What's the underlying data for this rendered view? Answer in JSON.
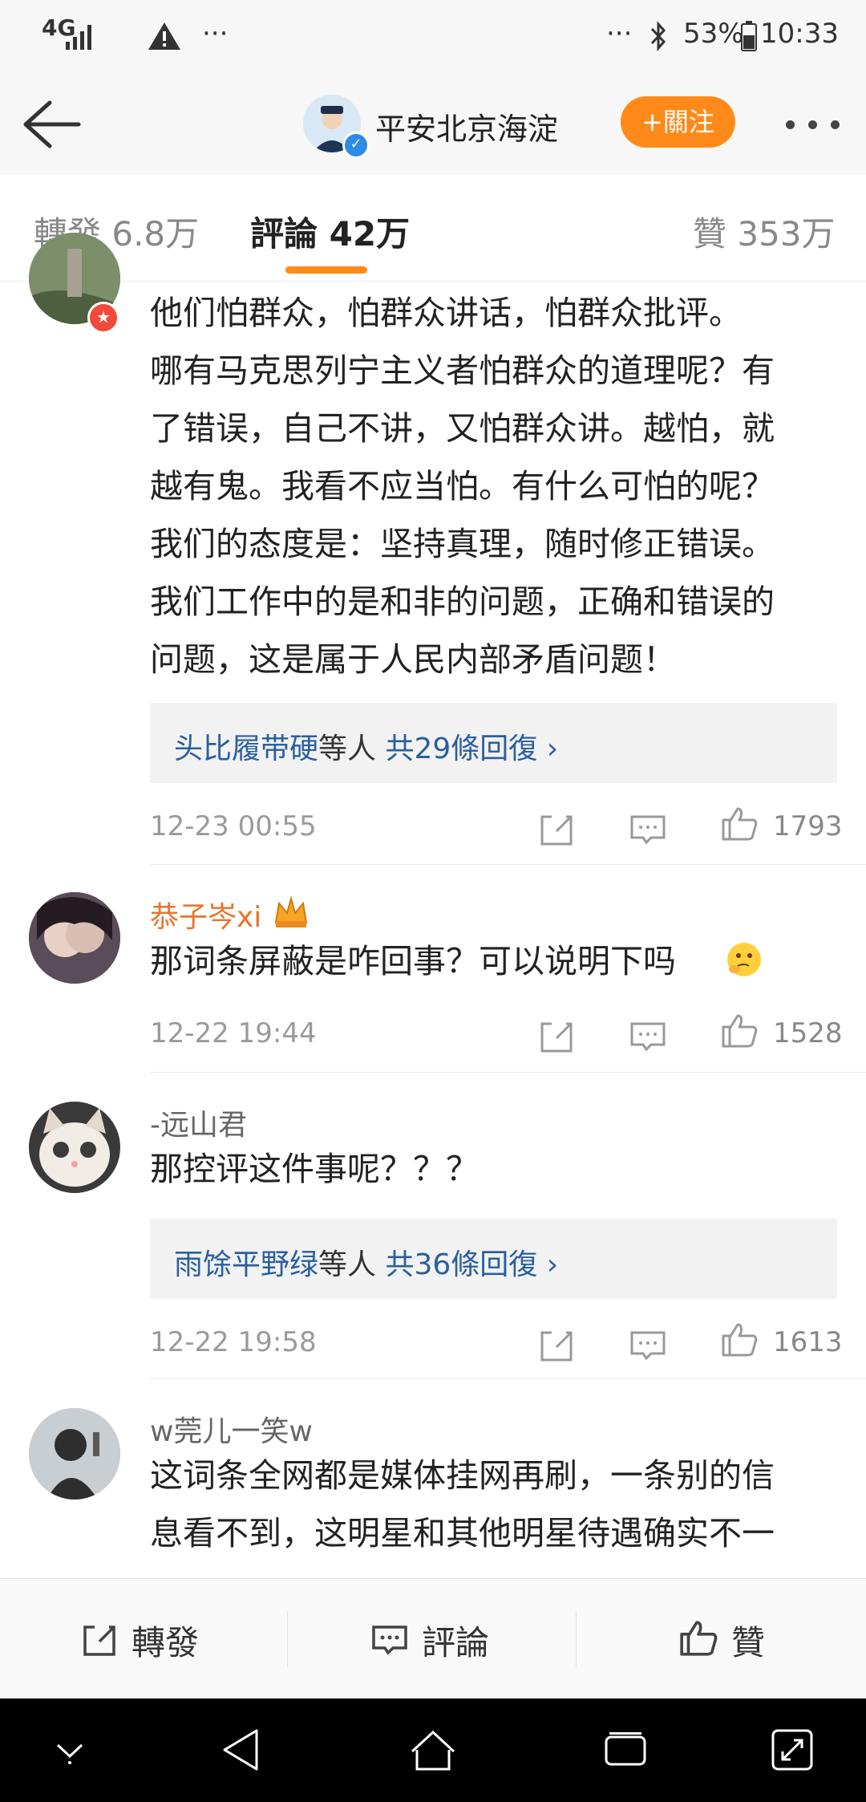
{
  "status_bar": {
    "network": "4G",
    "overflow": "···",
    "overflow_right": "···",
    "battery": "53%",
    "time": "10:33"
  },
  "header": {
    "account_name": "平安北京海淀",
    "follow_label": "+關注"
  },
  "tabs": {
    "reposts": "轉發 6.8万",
    "comments": "評論 42万",
    "likes": "贊 353万"
  },
  "comments": [
    {
      "lines": [
        "他们怕群众，怕群众讲话，怕群众批评。",
        "哪有马克思列宁主义者怕群众的道理呢？有",
        "了错误，自己不讲，又怕群众讲。越怕，就",
        "越有鬼。我看不应当怕。有什么可怕的呢？",
        "我们的态度是：坚持真理，随时修正错误。",
        "我们工作中的是和非的问题，正确和错误的",
        "问题，这是属于人民内部矛盾问题！"
      ],
      "replies": {
        "users": "头比履带硬",
        "mid": "等人",
        "count": "共29條回復"
      },
      "time": "12-23 00:55",
      "likes": "1793"
    },
    {
      "name": "恭子岑xi",
      "text": "那词条屏蔽是咋回事？可以说明下吗",
      "time": "12-22 19:44",
      "likes": "1528"
    },
    {
      "name": "-远山君",
      "text": "那控评这件事呢？？？",
      "replies": {
        "users": "雨馀平野绿",
        "mid": "等人",
        "count": "共36條回復"
      },
      "time": "12-22 19:58",
      "likes": "1613"
    },
    {
      "name": "w莞儿一笑w",
      "lines": [
        "这词条全网都是媒体挂网再刷，一条别的信",
        "息看不到，这明星和其他明星待遇确实不一"
      ]
    }
  ],
  "bottom_bar": {
    "repost": "轉發",
    "comment": "評論",
    "like": "贊"
  },
  "colors": {
    "accent": "#ff8a1a",
    "link": "#2a5f9e",
    "vip_name": "#e8742a"
  }
}
